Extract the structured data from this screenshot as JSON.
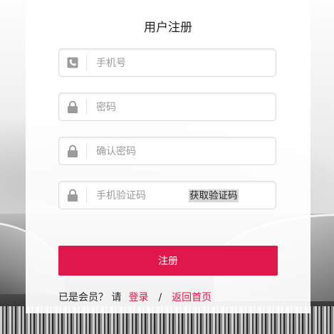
{
  "title": "用户注册",
  "fields": {
    "phone": {
      "placeholder": "手机号",
      "icon": "phone-icon"
    },
    "password": {
      "placeholder": "密码",
      "icon": "lock-icon"
    },
    "confirm": {
      "placeholder": "确认密码",
      "icon": "lock-icon"
    },
    "code": {
      "placeholder": "手机验证码",
      "icon": "lock-icon",
      "button": "获取验证码"
    }
  },
  "submit_label": "注册",
  "footer": {
    "prompt": "已是会员？ 请",
    "login": "登录",
    "separator": "/",
    "home": "返回首页"
  },
  "colors": {
    "accent": "#e0174a"
  }
}
